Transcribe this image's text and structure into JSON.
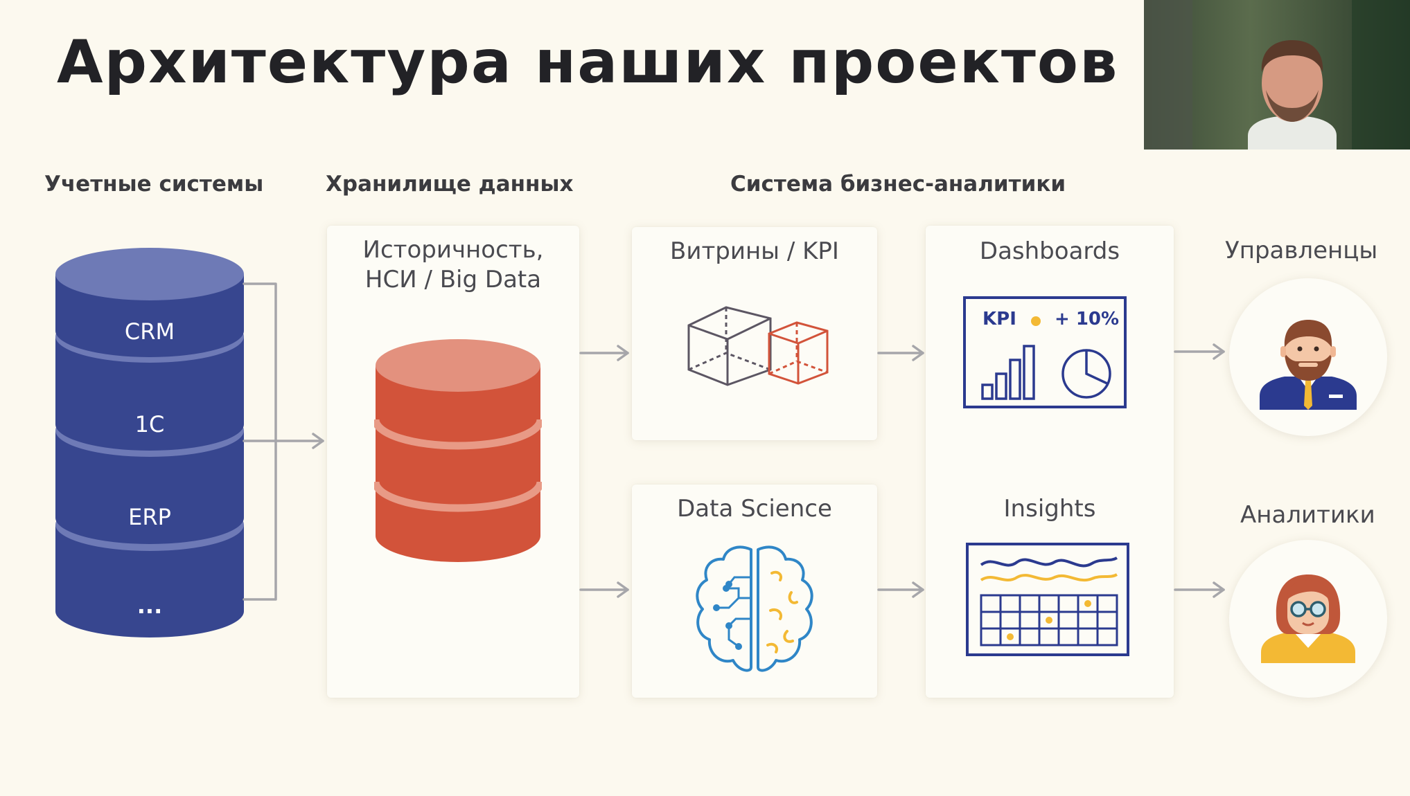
{
  "title": "Архитектура наших проектов",
  "columns": {
    "accounting": "Учетные системы",
    "warehouse": "Хранилище данных",
    "bi": "Система бизнес-аналитики"
  },
  "accounting_systems": [
    "CRM",
    "1C",
    "ERP",
    "..."
  ],
  "warehouse_card": {
    "line1": "Историчность,",
    "line2": "НСИ / Big Data"
  },
  "cards": {
    "marts": "Витрины / KPI",
    "data_science": "Data Science",
    "dashboards": "Dashboards",
    "insights": "Insights"
  },
  "dashboard_widget": {
    "kpi": "KPI",
    "delta": "+ 10%"
  },
  "people": {
    "managers": "Управленцы",
    "analysts": "Аналитики"
  },
  "colors": {
    "background": "#fcf9ef",
    "db_blue": "#37468f",
    "db_red": "#d2533a",
    "accent_yellow": "#f3b934",
    "icon_blue": "#2b3a8f"
  }
}
